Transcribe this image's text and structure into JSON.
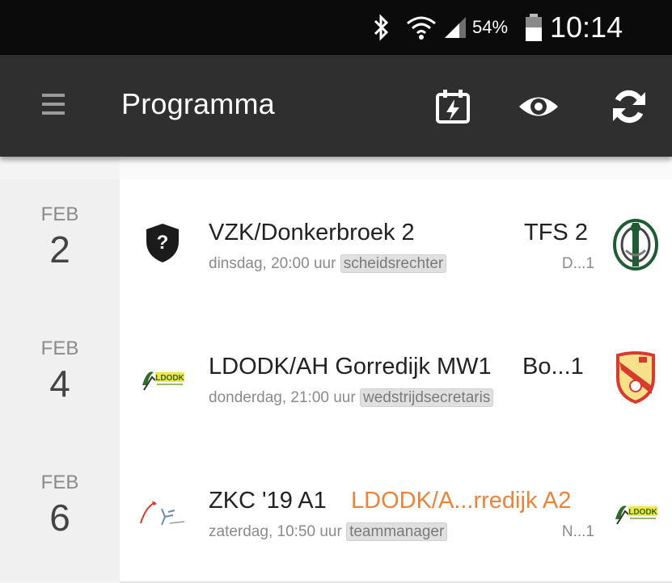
{
  "status_bar": {
    "battery_percent": "54%",
    "time": "10:14",
    "icons": [
      "bluetooth-icon",
      "wifi-icon",
      "signal-icon",
      "battery-icon"
    ]
  },
  "app_bar": {
    "title": "Programma",
    "actions": [
      "calendar-flash-icon",
      "eye-icon",
      "refresh-icon"
    ]
  },
  "matches": [
    {
      "month": "FEB",
      "day": "2",
      "home": "VZK/Donkerbroek 2",
      "away": "TFS 2",
      "time": "dinsdag, 20:00 uur",
      "role": "scheidsrechter",
      "extra": "D...1",
      "home_logo": "unknown-shield-icon",
      "away_logo": "tfs-club-logo"
    },
    {
      "month": "FEB",
      "day": "4",
      "home": "LDODK/AH Gorredijk MW1",
      "away": "Bo...1",
      "time": "donderdag, 21:00 uur",
      "role": "wedstrijdsecretaris",
      "extra": "",
      "home_logo": "ldodk-club-logo",
      "away_logo": "shield-club-logo"
    },
    {
      "month": "FEB",
      "day": "6",
      "home": "ZKC '19 A1",
      "away": "LDODK/A...rredijk A2",
      "time": "zaterdag, 10:50 uur",
      "role": "teammanager",
      "extra": "N...1",
      "home_logo": "zkc-club-logo",
      "away_logo": "ldodk-club-logo"
    }
  ],
  "colors": {
    "appbar": "#2f2f2f",
    "statusbar": "#0b0b0b",
    "highlight_team": "#e8843c"
  }
}
